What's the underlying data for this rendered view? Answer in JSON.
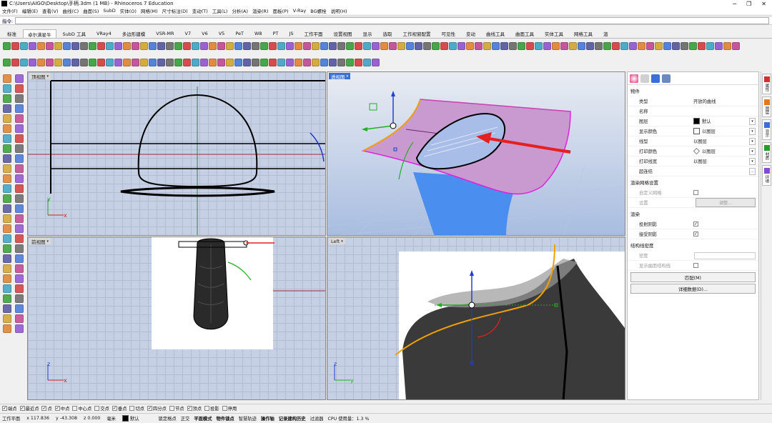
{
  "window": {
    "title": "C:\\Users\\AIGO\\Desktop\\手柄.3dm (1 MB) - Rhinoceros 7 Education"
  },
  "menu": [
    "文件(F)",
    "编辑(E)",
    "查看(V)",
    "曲线(C)",
    "曲面(S)",
    "SubD",
    "实体(O)",
    "网格(M)",
    "尺寸标注(D)",
    "变动(T)",
    "工具(L)",
    "分析(A)",
    "渲染(R)",
    "面板(P)",
    "V-Ray",
    "BG螺栓",
    "说明(H)"
  ],
  "command": {
    "label": "指令:",
    "value": ""
  },
  "tabs": [
    {
      "label": "标准",
      "active": false
    },
    {
      "label": "卓尔满星牛",
      "active": true
    },
    {
      "label": "SubD 工具",
      "active": false
    },
    {
      "label": "VRay4",
      "active": false
    },
    {
      "label": "多边形建模",
      "active": false
    },
    {
      "label": "VSR-MR",
      "active": false
    },
    {
      "label": "V7",
      "active": false
    },
    {
      "label": "V6",
      "active": false
    },
    {
      "label": "V5",
      "active": false
    },
    {
      "label": "PeT",
      "active": false
    },
    {
      "label": "W8",
      "active": false
    },
    {
      "label": "PT",
      "active": false
    },
    {
      "label": "JS",
      "active": false
    },
    {
      "label": "工作平面",
      "active": false
    },
    {
      "label": "设置视图",
      "active": false
    },
    {
      "label": "显示",
      "active": false
    },
    {
      "label": "选取",
      "active": false
    },
    {
      "label": "工作视窗配置",
      "active": false
    },
    {
      "label": "可见性",
      "active": false
    },
    {
      "label": "变动",
      "active": false
    },
    {
      "label": "曲线工具",
      "active": false
    },
    {
      "label": "曲面工具",
      "active": false
    },
    {
      "label": "实体工具",
      "active": false
    },
    {
      "label": "网格工具",
      "active": false
    },
    {
      "label": "渲",
      "active": false
    }
  ],
  "viewports": {
    "top": {
      "label": "顶视图",
      "axis_y": "y",
      "axis_x": "x"
    },
    "perspective": {
      "label": "透视图"
    },
    "front": {
      "label": "前视图",
      "axis_z": "z",
      "axis_x": "x"
    },
    "left": {
      "label": "Left",
      "axis_z": "z",
      "axis_y": "y"
    }
  },
  "properties": {
    "section_object": "物件",
    "rows": [
      {
        "key": "类型",
        "value": "开放的曲线",
        "swatch": null,
        "dropdown": false
      },
      {
        "key": "名称",
        "value": "",
        "swatch": null,
        "dropdown": false
      },
      {
        "key": "图层",
        "value": "默认",
        "swatch": "#000000",
        "dropdown": true
      },
      {
        "key": "显示颜色",
        "value": "以图层",
        "swatch": "#ffffff",
        "dropdown": true
      },
      {
        "key": "线型",
        "value": "以图层",
        "swatch": null,
        "dropdown": true
      },
      {
        "key": "打印颜色",
        "value": "以图层",
        "swatch": "diamond",
        "dropdown": true
      },
      {
        "key": "打印线宽",
        "value": "以图层",
        "swatch": null,
        "dropdown": true
      },
      {
        "key": "超连结",
        "value": "",
        "swatch": null,
        "dropdown": false,
        "more": "..."
      }
    ],
    "section_render_mesh": "渲染网格设置",
    "custom_mesh_label": "自定义网格",
    "settings_label": "设置",
    "adjust_button": "调整...",
    "section_render": "渲染",
    "cast_shadow_label": "投射阴影",
    "receive_shadow_label": "接受阴影",
    "section_isocurve": "结构线密度",
    "density_label": "密度",
    "show_isocurve_label": "显示曲面结构线",
    "match_button": "匹配(M)",
    "details_button": "详细数据(D)..."
  },
  "side_tabs": [
    "属性",
    "图层",
    "显示",
    "材质",
    "环境"
  ],
  "snaps": [
    {
      "label": "端点",
      "checked": true
    },
    {
      "label": "最近点",
      "checked": true
    },
    {
      "label": "点",
      "checked": true
    },
    {
      "label": "中点",
      "checked": true
    },
    {
      "label": "中心点",
      "checked": false
    },
    {
      "label": "交点",
      "checked": false
    },
    {
      "label": "垂点",
      "checked": true
    },
    {
      "label": "切点",
      "checked": false
    },
    {
      "label": "四分点",
      "checked": true
    },
    {
      "label": "节点",
      "checked": false
    },
    {
      "label": "顶点",
      "checked": true
    },
    {
      "label": "投影",
      "checked": false
    },
    {
      "label": "停用",
      "checked": false
    }
  ],
  "status": {
    "cplane": "工作平面",
    "x": "x 117.836",
    "y": "y -43.308",
    "z": "z 0.000",
    "units": "毫米",
    "layer": "默认",
    "items": [
      "锁定格点",
      "正交",
      "平面模式",
      "物件锁点",
      "智慧轨迹",
      "操作轴",
      "记录建构历史",
      "过滤器",
      "CPU 使用量：1.3 %"
    ],
    "bold_items": [
      "平面模式",
      "物件锁点",
      "操作轴",
      "记录建构历史"
    ]
  },
  "colors": {
    "accent": "#3a6fd8",
    "surface": "#c79fcd",
    "curve_orange": "#f0a000",
    "arrow_red": "#e62020"
  }
}
